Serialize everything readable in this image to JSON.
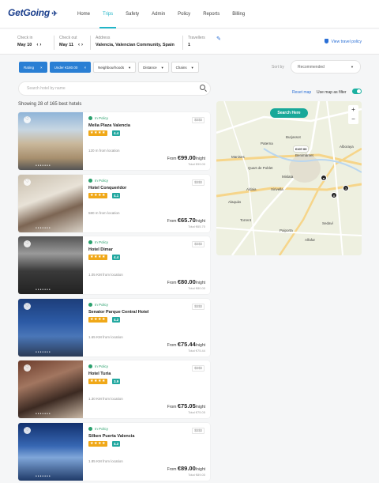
{
  "brand": {
    "name": "GetGoing"
  },
  "nav": {
    "items": [
      "Home",
      "Trips",
      "Safety",
      "Admin",
      "Policy",
      "Reports",
      "Billing"
    ],
    "active": "Trips"
  },
  "search": {
    "checkin_label": "Check in",
    "checkin_value": "May 10",
    "checkout_label": "Check out",
    "checkout_value": "May 11",
    "address_label": "Address",
    "address_value": "Valencia, Valencian Community, Spain",
    "travellers_label": "Travellers",
    "travellers_value": "1",
    "policy_link": "View travel policy"
  },
  "filters": {
    "rating": "Rating",
    "under": "Under €180.00",
    "neighbourhoods": "Neighbourhoods",
    "distance": "Distance",
    "chains": "Chains",
    "sort_label": "Sort by",
    "sort_value": "Recommended"
  },
  "hotel_search": {
    "placeholder": "Search hotel by name"
  },
  "results": {
    "showing": "Showing 28 of 165 best hotels"
  },
  "map": {
    "reset": "Reset map",
    "use_as_filter": "Use map as filter",
    "search_here": "Search Here",
    "labels": [
      "Burjassot",
      "Paterna",
      "Alboraya",
      "Manises",
      "Quart de Poblet",
      "Mislata",
      "Aldaia",
      "Xirivella",
      "Alaquàs",
      "Torrent",
      "Paiporta",
      "Alfafar",
      "Benimàmet",
      "Sedaví"
    ],
    "pins": [
      "€107.00"
    ]
  },
  "hotels": [
    {
      "policy": "In Policy",
      "name": "Melia Plaza Valencia",
      "stars": "★★★★",
      "score": "4.4",
      "tier": "$$$$",
      "distance": "120 m from location",
      "from": "From",
      "price": "€99.00",
      "night": "/night",
      "total": "Total €99.00",
      "img": "a"
    },
    {
      "policy": "In Policy",
      "name": "Hotel Conqueridor",
      "stars": "★★★★",
      "score": "4.1",
      "tier": "$$$$",
      "distance": "580 m from location",
      "from": "From",
      "price": "€65.70",
      "night": "/night",
      "total": "Total €65.70",
      "img": "b"
    },
    {
      "policy": "In Policy",
      "name": "Hotel Dimar",
      "stars": "★★★★",
      "score": "4.4",
      "tier": "$$$$",
      "distance": "1.05 KM from location",
      "from": "From",
      "price": "€80.00",
      "night": "/night",
      "total": "Total €80.00",
      "img": "c"
    },
    {
      "policy": "In Policy",
      "name": "Senator Parque Central Hotel",
      "stars": "★★★★",
      "score": "4.2",
      "tier": "$$$$",
      "distance": "1.65 KM from location",
      "from": "From",
      "price": "€75.44",
      "night": "/night",
      "total": "Total €75.44",
      "img": "d"
    },
    {
      "policy": "In Policy",
      "name": "Hotel Turia",
      "stars": "★★★★",
      "score": "3.9",
      "tier": "$$$$",
      "distance": "1.30 KM from location",
      "from": "From",
      "price": "€75.05",
      "night": "/night",
      "total": "Total €75.05",
      "img": "e"
    },
    {
      "policy": "In Policy",
      "name": "Silken Puerta Valencia",
      "stars": "★★★★",
      "score": "4.2",
      "tier": "$$$$",
      "distance": "1.85 KM from location",
      "from": "From",
      "price": "€89.00",
      "night": "/night",
      "total": "Total €89.00",
      "img": "f"
    }
  ]
}
